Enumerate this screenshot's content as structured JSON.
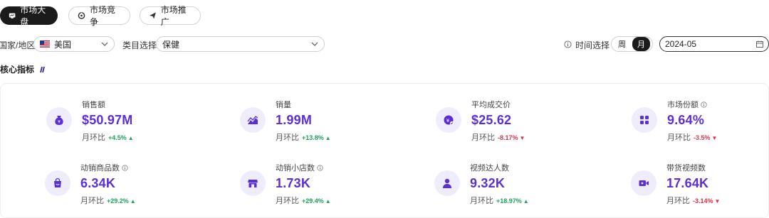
{
  "tabs": [
    {
      "label": "市场大盘",
      "icon": "chart-board-icon",
      "active": true
    },
    {
      "label": "市场竞争",
      "icon": "compete-icon",
      "active": false
    },
    {
      "label": "市场推广",
      "icon": "send-icon",
      "active": false
    }
  ],
  "filters": {
    "country_label": "国家/地区",
    "country_value": "美国",
    "category_label": "类目选择",
    "category_value": "保健",
    "time_label": "时间选择",
    "period_week": "周",
    "period_month": "月",
    "date_value": "2024-05"
  },
  "section_title": "核心指标",
  "metrics": [
    {
      "label": "销售额",
      "value": "$50.97M",
      "change_label": "月环比",
      "change": "+4.5%",
      "trend": "up",
      "icon": "money-bag-icon"
    },
    {
      "label": "销量",
      "value": "1.99M",
      "change_label": "月环比",
      "change": "+13.8%",
      "trend": "up",
      "icon": "trend-chart-icon"
    },
    {
      "label": "平均成交价",
      "value": "$25.62",
      "change_label": "月环比",
      "change": "-8.17%",
      "trend": "down",
      "icon": "price-tag-icon"
    },
    {
      "label": "市场份额",
      "value": "9.64%",
      "change_label": "月环比",
      "change": "-3.5%",
      "trend": "down",
      "icon": "grid-apps-icon",
      "info": true
    },
    {
      "label": "动销商品数",
      "value": "6.34K",
      "change_label": "月环比",
      "change": "+29.2%",
      "trend": "up",
      "icon": "shopping-bag-icon",
      "info": true
    },
    {
      "label": "动销小店数",
      "value": "1.73K",
      "change_label": "月环比",
      "change": "+29.4%",
      "trend": "up",
      "icon": "store-icon",
      "info": true
    },
    {
      "label": "视频达人数",
      "value": "9.32K",
      "change_label": "月环比",
      "change": "+18.97%",
      "trend": "up",
      "icon": "person-icon"
    },
    {
      "label": "带货视频数",
      "value": "17.64K",
      "change_label": "月环比",
      "change": "-3.14%",
      "trend": "down",
      "icon": "video-camera-icon"
    }
  ],
  "colors": {
    "accent": "#5b2fd4",
    "up": "#1aa35c",
    "down": "#d9334a"
  }
}
